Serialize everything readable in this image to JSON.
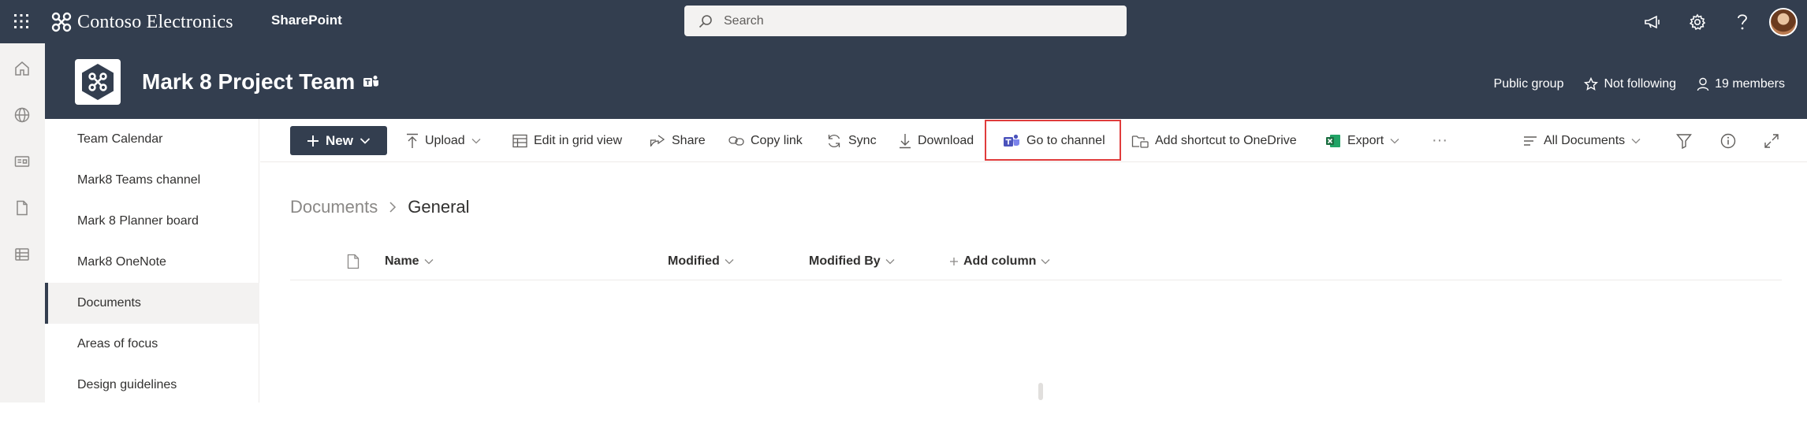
{
  "suite": {
    "brand": "Contoso Electronics",
    "app": "SharePoint",
    "search_placeholder": "Search"
  },
  "site": {
    "title": "Mark 8 Project Team",
    "privacy": "Public group",
    "follow": "Not following",
    "members": "19 members"
  },
  "nav": {
    "items": [
      {
        "label": "Team Calendar"
      },
      {
        "label": "Mark8 Teams channel"
      },
      {
        "label": "Mark 8 Planner board"
      },
      {
        "label": "Mark8 OneNote"
      },
      {
        "label": "Documents"
      },
      {
        "label": "Areas of focus"
      },
      {
        "label": "Design guidelines"
      }
    ],
    "selected": "Documents"
  },
  "command": {
    "new": "New",
    "upload": "Upload",
    "edit_grid": "Edit in grid view",
    "share": "Share",
    "copy_link": "Copy link",
    "sync": "Sync",
    "download": "Download",
    "go_to_channel": "Go to channel",
    "add_shortcut": "Add shortcut to OneDrive",
    "export": "Export",
    "more": "···",
    "view": "All Documents"
  },
  "breadcrumb": {
    "root": "Documents",
    "current": "General"
  },
  "columns": {
    "name": "Name",
    "modified": "Modified",
    "modified_by": "Modified By",
    "add_column": "Add column"
  },
  "colors": {
    "suite_bg": "#333e4f",
    "header_bg": "#333e4f",
    "highlight": "#e03c3c",
    "teams_purple": "#4b53bc",
    "excel_green": "#1d6f42"
  }
}
